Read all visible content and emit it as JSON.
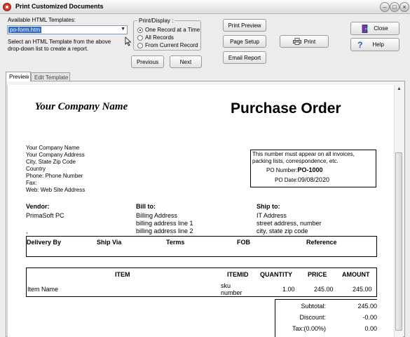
{
  "window": {
    "title": "Print Customized Documents",
    "min": "–",
    "max": "□",
    "close": "×"
  },
  "templates": {
    "label": "Available HTML Templates:",
    "selected": "po-form.htm",
    "help": "Select an HTML Template from the above drop-down list to create a report."
  },
  "print_display": {
    "title": "Print/Display :",
    "options": [
      "One Record at a Time",
      "All Records",
      "From Current Record"
    ],
    "selected_index": 0
  },
  "buttons": {
    "previous": "Previous",
    "next": "Next",
    "print_preview": "Print Preview",
    "page_setup": "Page Setup",
    "email_report": "Email Report",
    "print": "Print",
    "close": "Close",
    "help": "Help"
  },
  "tabs": [
    "Preview",
    "Edit Template"
  ],
  "document": {
    "company_name": "Your Company Name",
    "title": "Purchase Order",
    "company_address": [
      "Your Company Name",
      "Your Company Address",
      "City, State Zip Code",
      "Country",
      "Phone: Phone Number",
      "Fax:",
      "Web: Web Site Address"
    ],
    "notice": "This number must appear on all invoices, packing lists, correspondence, etc.",
    "po_number_label": "PO Number:",
    "po_number": "PO-1000",
    "po_date_label": "PO Date:",
    "po_date": "09/08/2020",
    "vendor_label": "Vendor:",
    "vendor": [
      "PrimaSoft PC",
      ","
    ],
    "bill_label": "Bill to:",
    "bill": [
      "Billing Address",
      "billing address line 1",
      "billing address line 2"
    ],
    "ship_label": "Ship to:",
    "ship": [
      "IT Address",
      "street address, number",
      "city, state zip code"
    ],
    "delivery_headers": [
      "Delivery By",
      "Ship Via",
      "Terms",
      "FOB",
      "Reference"
    ],
    "item_headers": [
      "ITEM",
      "ITEMID",
      "QUANTITY",
      "PRICE",
      "AMOUNT"
    ],
    "items": [
      {
        "item": "Item Name",
        "itemid_line1": "sku",
        "itemid_line2": "number",
        "quantity": "1.00",
        "price": "245.00",
        "amount": "245.00"
      }
    ],
    "totals": [
      {
        "label": "Subtotal:",
        "value": "245.00"
      },
      {
        "label": "Discount:",
        "value": "-0.00"
      },
      {
        "label": "Tax:(0.00%)",
        "value": "0.00"
      }
    ]
  }
}
